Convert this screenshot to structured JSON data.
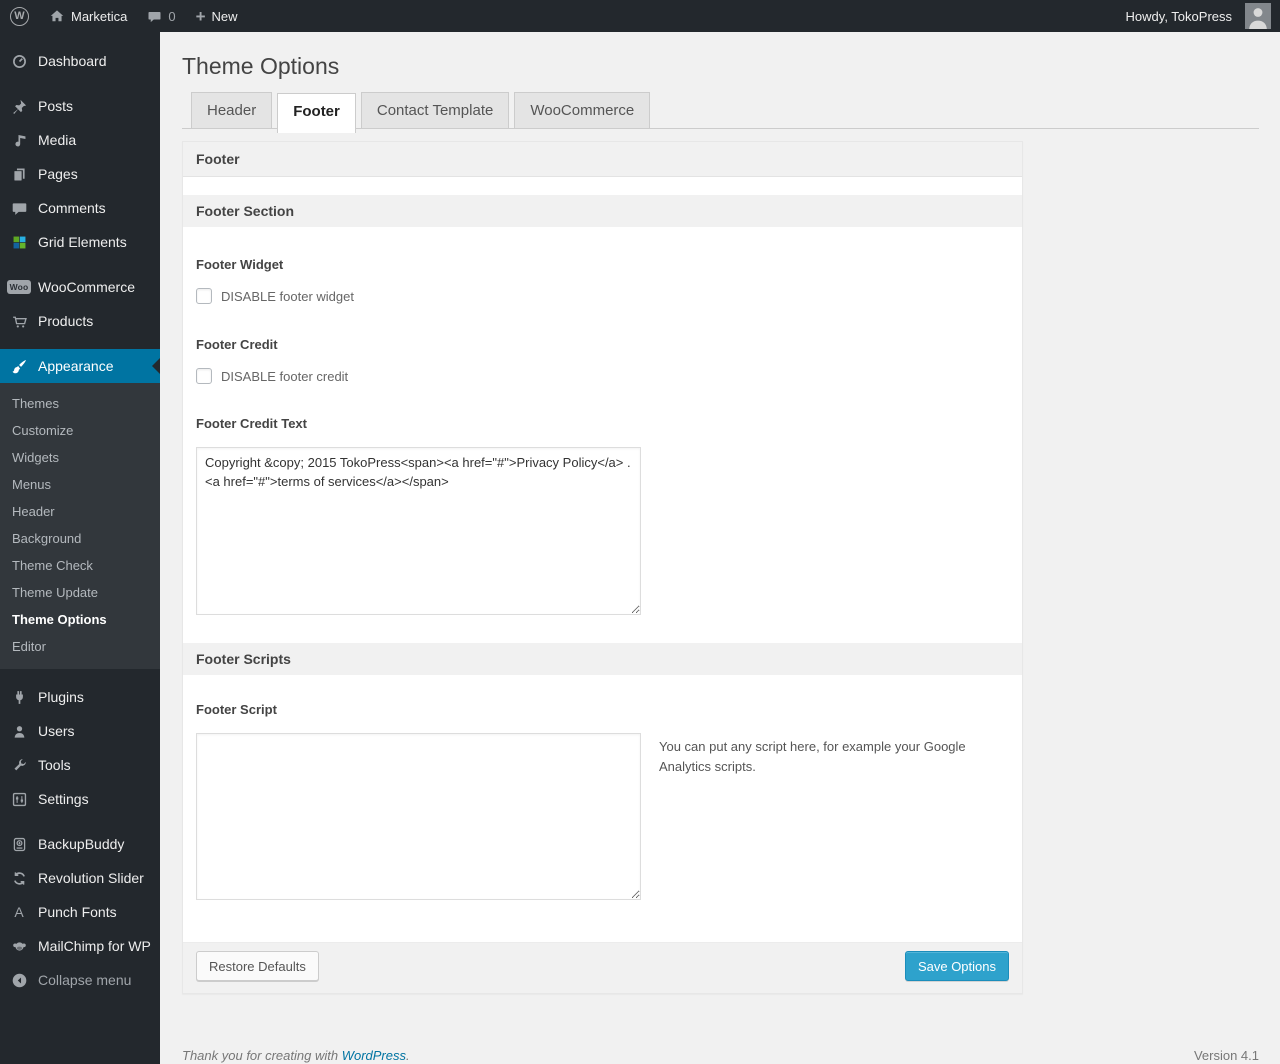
{
  "admin_bar": {
    "wp_logo_glyph": "W",
    "site_name": "Marketica",
    "comment_count": "0",
    "plus_glyph": "+",
    "new_label": "New",
    "howdy": "Howdy, TokoPress"
  },
  "sidebar": {
    "items": [
      {
        "label": "Dashboard",
        "icon": "dashboard-icon"
      },
      {
        "label": "Posts",
        "icon": "pin-icon"
      },
      {
        "label": "Media",
        "icon": "media-icon"
      },
      {
        "label": "Pages",
        "icon": "pages-icon"
      },
      {
        "label": "Comments",
        "icon": "comments-icon"
      },
      {
        "label": "Grid Elements",
        "icon": "grid-elements-icon"
      },
      {
        "label": "WooCommerce",
        "icon": "woocommerce-icon"
      },
      {
        "label": "Products",
        "icon": "cart-icon"
      },
      {
        "label": "Appearance",
        "icon": "appearance-icon",
        "active": true
      },
      {
        "label": "Plugins",
        "icon": "plugins-icon"
      },
      {
        "label": "Users",
        "icon": "users-icon"
      },
      {
        "label": "Tools",
        "icon": "tools-icon"
      },
      {
        "label": "Settings",
        "icon": "settings-icon"
      },
      {
        "label": "BackupBuddy",
        "icon": "backupbuddy-icon"
      },
      {
        "label": "Revolution Slider",
        "icon": "revolution-slider-icon"
      },
      {
        "label": "Punch Fonts",
        "icon": "punch-fonts-icon"
      },
      {
        "label": "MailChimp for WP",
        "icon": "mailchimp-icon"
      },
      {
        "label": "Collapse menu",
        "icon": "collapse-icon"
      }
    ],
    "woo_badge_text": "Woo",
    "punch_fonts_glyph": "A",
    "appearance_submenu": [
      {
        "label": "Themes"
      },
      {
        "label": "Customize"
      },
      {
        "label": "Widgets"
      },
      {
        "label": "Menus"
      },
      {
        "label": "Header"
      },
      {
        "label": "Background"
      },
      {
        "label": "Theme Check"
      },
      {
        "label": "Theme Update"
      },
      {
        "label": "Theme Options",
        "current": true
      },
      {
        "label": "Editor"
      }
    ]
  },
  "page": {
    "title": "Theme Options",
    "tabs": [
      {
        "label": "Header"
      },
      {
        "label": "Footer",
        "active": true
      },
      {
        "label": "Contact Template"
      },
      {
        "label": "WooCommerce"
      }
    ]
  },
  "panel": {
    "header": "Footer",
    "section_header": "Footer Section",
    "footer_widget": {
      "label": "Footer Widget",
      "checkbox_label": "DISABLE footer widget",
      "checked": false
    },
    "footer_credit": {
      "label": "Footer Credit",
      "checkbox_label": "DISABLE footer credit",
      "checked": false
    },
    "footer_credit_text": {
      "label": "Footer Credit Text",
      "value": "Copyright &copy; 2015 TokoPress<span><a href=\"#\">Privacy Policy</a> . <a href=\"#\">terms of services</a></span>"
    },
    "scripts_section_header": "Footer Scripts",
    "footer_script": {
      "label": "Footer Script",
      "value": "",
      "description": "You can put any script here, for example your Google Analytics scripts."
    },
    "buttons": {
      "restore": "Restore Defaults",
      "save": "Save Options"
    }
  },
  "footer": {
    "thanks_prefix": "Thank you for creating with ",
    "wordpress_link": "WordPress",
    "thanks_suffix": ".",
    "version": "Version 4.1"
  },
  "colors": {
    "accent": "#0074a2",
    "primary_button": "#2ea2cc",
    "adminbar_bg": "#23282d",
    "submenu_bg": "#32373c",
    "page_bg": "#f1f1f1"
  }
}
